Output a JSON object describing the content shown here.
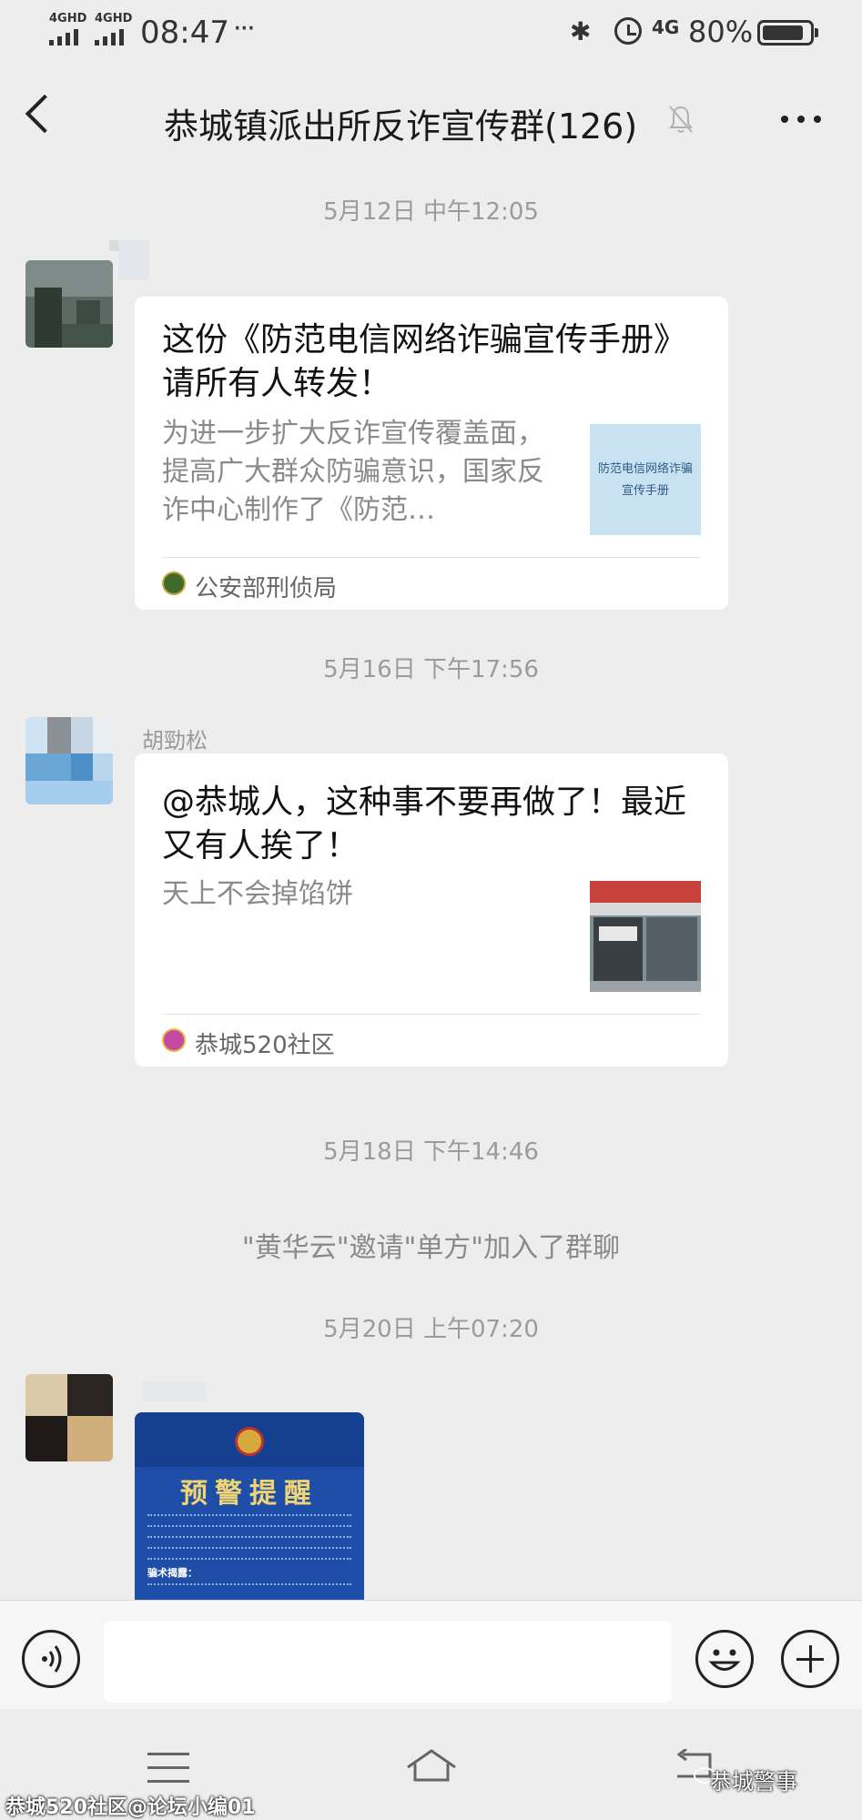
{
  "status_bar": {
    "network_1": "4GHD",
    "network_2": "4GHD",
    "time": "08:47",
    "more": "···",
    "network_3": "4G",
    "battery_text": "80%",
    "battery_level": 0.8
  },
  "header": {
    "title": "恭城镇派出所反诈宣传群(126)"
  },
  "messages": [
    {
      "timestamp": "5月12日 中午12:05",
      "card_title": "这份《防范电信网络诈骗宣传手册》请所有人转发！",
      "card_desc": "为进一步扩大反诈宣传覆盖面，提高广大群众防骗意识，国家反诈中心制作了《防范…",
      "thumb_text": "防范电信网络诈骗宣传手册",
      "source": "公安部刑侦局"
    },
    {
      "timestamp": "5月16日 下午17:56",
      "sender": "胡勁松",
      "card_title": "@恭城人，这种事不要再做了！最近又有人挨了！",
      "card_desc": "天上不会掉馅饼",
      "source": "恭城520社区"
    }
  ],
  "system": {
    "timestamp": "5月18日 下午14:46",
    "text": "\"黄华云\"邀请\"单方\"加入了群聊"
  },
  "last_message": {
    "timestamp": "5月20日 上午07:20",
    "image_title": "预警提醒",
    "image_subtitle": "骗术揭露："
  },
  "watermarks": {
    "right": "恭城警事",
    "left": "恭城520社区@论坛小编01"
  },
  "colors": {
    "background": "#ededed",
    "card": "#ffffff",
    "timestamp": "#9b9b9b",
    "image_blue": "#1f4ea8"
  }
}
